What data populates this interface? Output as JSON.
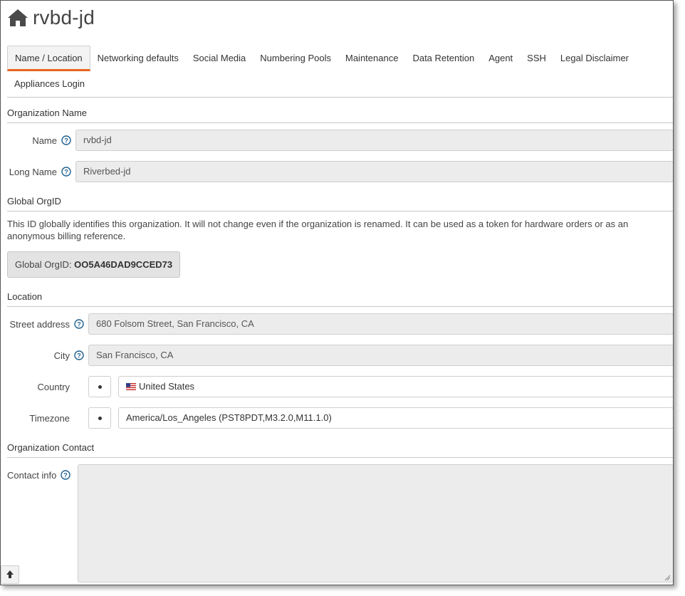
{
  "header": {
    "title": "rvbd-jd",
    "icon": "home-icon"
  },
  "tabs": [
    {
      "label": "Name / Location",
      "active": true
    },
    {
      "label": "Networking defaults"
    },
    {
      "label": "Social Media"
    },
    {
      "label": "Numbering Pools"
    },
    {
      "label": "Maintenance"
    },
    {
      "label": "Data Retention"
    },
    {
      "label": "Agent"
    },
    {
      "label": "SSH"
    },
    {
      "label": "Legal Disclaimer"
    },
    {
      "label": "Appliances Login"
    }
  ],
  "org_name": {
    "heading": "Organization Name",
    "name_label": "Name",
    "name_value": "rvbd-jd",
    "long_name_label": "Long Name",
    "long_name_value": "Riverbed-jd"
  },
  "global_orgid": {
    "heading": "Global OrgID",
    "description": "This ID globally identifies this organization. It will not change even if the organization is renamed. It can be used as a token for hardware orders or as an anonymous billing reference.",
    "label": "Global OrgID:",
    "value": "OO5A46DAD9CCED73"
  },
  "location": {
    "heading": "Location",
    "street_label": "Street address",
    "street_value": "680 Folsom Street, San Francisco, CA",
    "city_label": "City",
    "city_value": "San Francisco, CA",
    "country_label": "Country",
    "country_value": "United States",
    "timezone_label": "Timezone",
    "timezone_value": "America/Los_Angeles (PST8PDT,M3.2.0,M11.1.0)"
  },
  "contact": {
    "heading": "Organization Contact",
    "label": "Contact info",
    "value": ""
  },
  "colors": {
    "accent": "#e8651f",
    "help": "#1f5f8f"
  }
}
